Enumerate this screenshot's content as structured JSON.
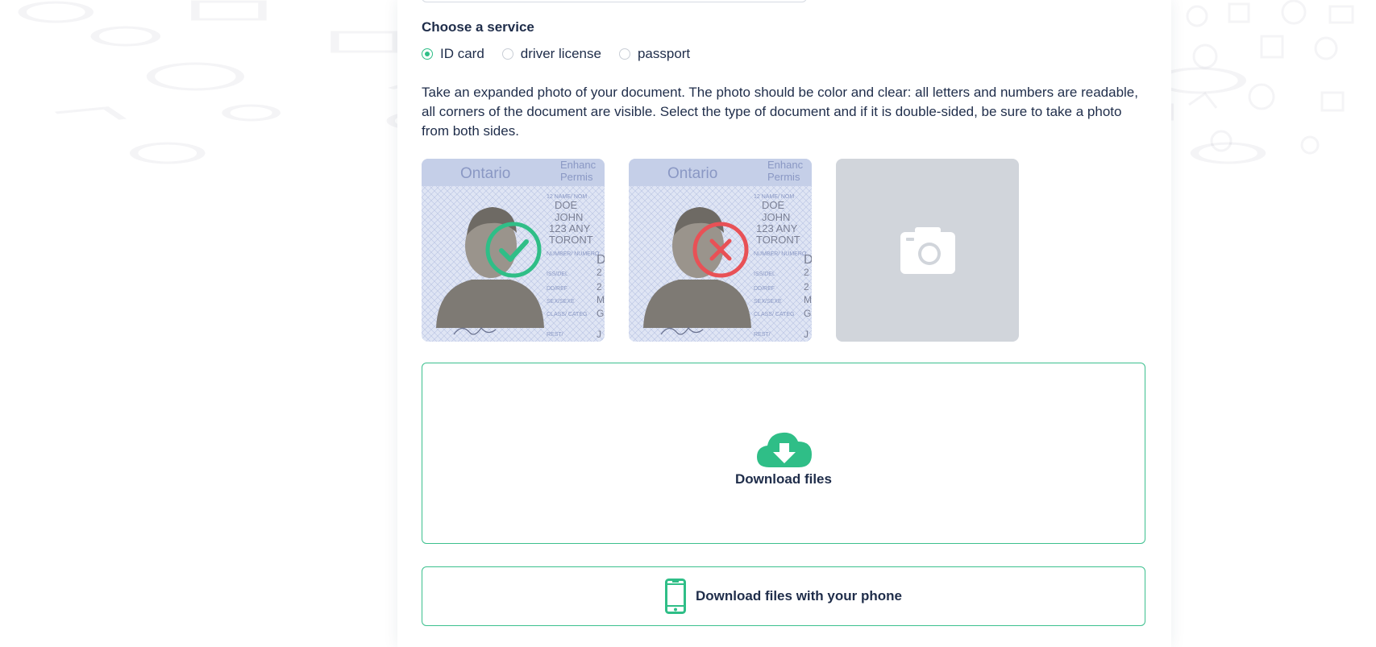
{
  "service": {
    "title": "Choose a service",
    "options": [
      {
        "label": "ID card",
        "selected": true
      },
      {
        "label": "driver license",
        "selected": false
      },
      {
        "label": "passport",
        "selected": false
      }
    ]
  },
  "instructions": "Take an expanded photo of your document. The photo should be color and clear: all letters and numbers are readable, all corners of the document are visible. Select the type of document and if it is double-sided, be sure to take a photo from both sides.",
  "examples": {
    "card_text": {
      "province": "Ontario",
      "header_1": "Enhanc",
      "header_2": "Permis",
      "name_field": "12 NAME/ NOM",
      "surname": "DOE",
      "given_name": "JOHN",
      "address_1": "123 ANY",
      "address_2": "TORONT",
      "number_field": "NUMBER/ NUMERO",
      "issued_field": "ISS/DEL",
      "dd_field": "DD/REF",
      "sex_field": "SEX/SEXE",
      "class_field": "CLASS/ CATEG",
      "rest_field": "REST/",
      "letter_d": "D",
      "letter_m1": "M",
      "letter_m2": "M",
      "letter_g": "G",
      "letter_j": "J",
      "num_1": "2",
      "num_2": "2"
    },
    "good_icon": "check-circle-icon",
    "bad_icon": "cross-circle-icon",
    "placeholder_icon": "camera-icon"
  },
  "upload": {
    "label": "Download files",
    "icon": "cloud-download-icon"
  },
  "phone": {
    "label": "Download files with your phone",
    "icon": "smartphone-icon"
  },
  "colors": {
    "accent": "#2fbe87",
    "error": "#e85156",
    "text": "#1f2d4a",
    "placeholder": "#d1d5db"
  }
}
